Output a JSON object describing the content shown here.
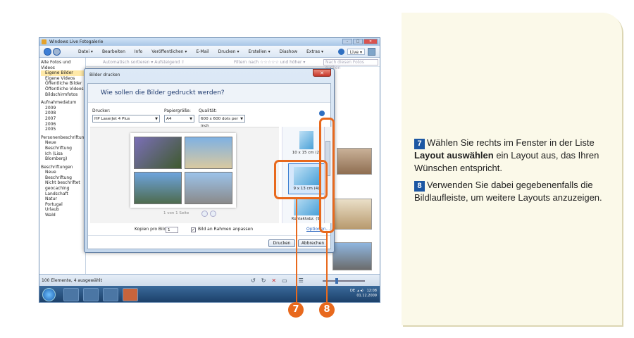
{
  "window": {
    "title": "Windows Live Fotogalerie"
  },
  "menu": [
    "Datei ▾",
    "Bearbeiten",
    "Info",
    "Veröffentlichen ▾",
    "E-Mail",
    "Drucken ▾",
    "Erstellen ▾",
    "Diashow",
    "Extras ▾"
  ],
  "signin": "Live ▾",
  "sidebar": {
    "items": [
      "Alle Fotos und Videos",
      "Eigene Bilder",
      "Eigene Videos",
      "Öffentliche Bilder",
      "Öffentliche Videos",
      "Bildschirmfotos"
    ],
    "years_header": "Aufnahmedatum",
    "years": [
      "2009",
      "2008",
      "2007",
      "2006",
      "2005"
    ],
    "people_header": "Personenbeschriftung",
    "people": [
      "Neue Beschriftung",
      "Ich (Lisa Blomberg)"
    ],
    "tags_header": "Beschriftungen",
    "tags": [
      "Neue Beschriftung",
      "Nicht beschriftet",
      "geocaching",
      "Landschaft",
      "Natur",
      "Portugal",
      "Urlaub",
      "Wald"
    ]
  },
  "topbar": {
    "sort": "Automatisch sortieren ▾  Aufsteigend ⇧",
    "filter": "Filtern nach ☆☆☆☆☆ und höher ▾",
    "search_placeholder": "Nach diesen Fotos suchen"
  },
  "statusbar": {
    "text": "100 Elemente, 4 ausgewählt"
  },
  "tray": {
    "lang": "DE",
    "time": "12:08",
    "date": "01.12.2009"
  },
  "dialog": {
    "title": "Bilder drucken",
    "heading": "Wie sollen die Bilder gedruckt werden?",
    "printer_label": "Drucker:",
    "printer_value": "HP LaserJet 4 Plus",
    "paper_label": "Papiergröße:",
    "paper_value": "A4",
    "quality_label": "Qualität:",
    "quality_value": "600 x 600 dots per inch",
    "pager": "1 von 1 Seite",
    "layouts": [
      "10 x 15 cm (2)",
      "9 x 13 cm (4)",
      "Kontaktabz. (9)"
    ],
    "copies_label": "Kopien pro Bild:",
    "copies_value": "1",
    "fit_label": "Bild an Rahmen anpassen",
    "options_link": "Optionen...",
    "print_button": "Drucken",
    "cancel_button": "Abbrechen"
  },
  "badges": [
    "7",
    "8"
  ],
  "instructions": [
    {
      "num": "7",
      "pre": "Wählen Sie rechts im Fenster in der Liste ",
      "bold": "Layout auswählen",
      "post": " ein Layout aus, das Ihren Wünschen entspricht."
    },
    {
      "num": "8",
      "text": "Verwenden Sie dabei gegebenenfalls die Bildlaufleiste, um weitere Layouts anzuzeigen."
    }
  ],
  "colors": {
    "accent": "#e8691d",
    "step_badge": "#1c57a3",
    "panel_bg": "#fbf9e9"
  }
}
